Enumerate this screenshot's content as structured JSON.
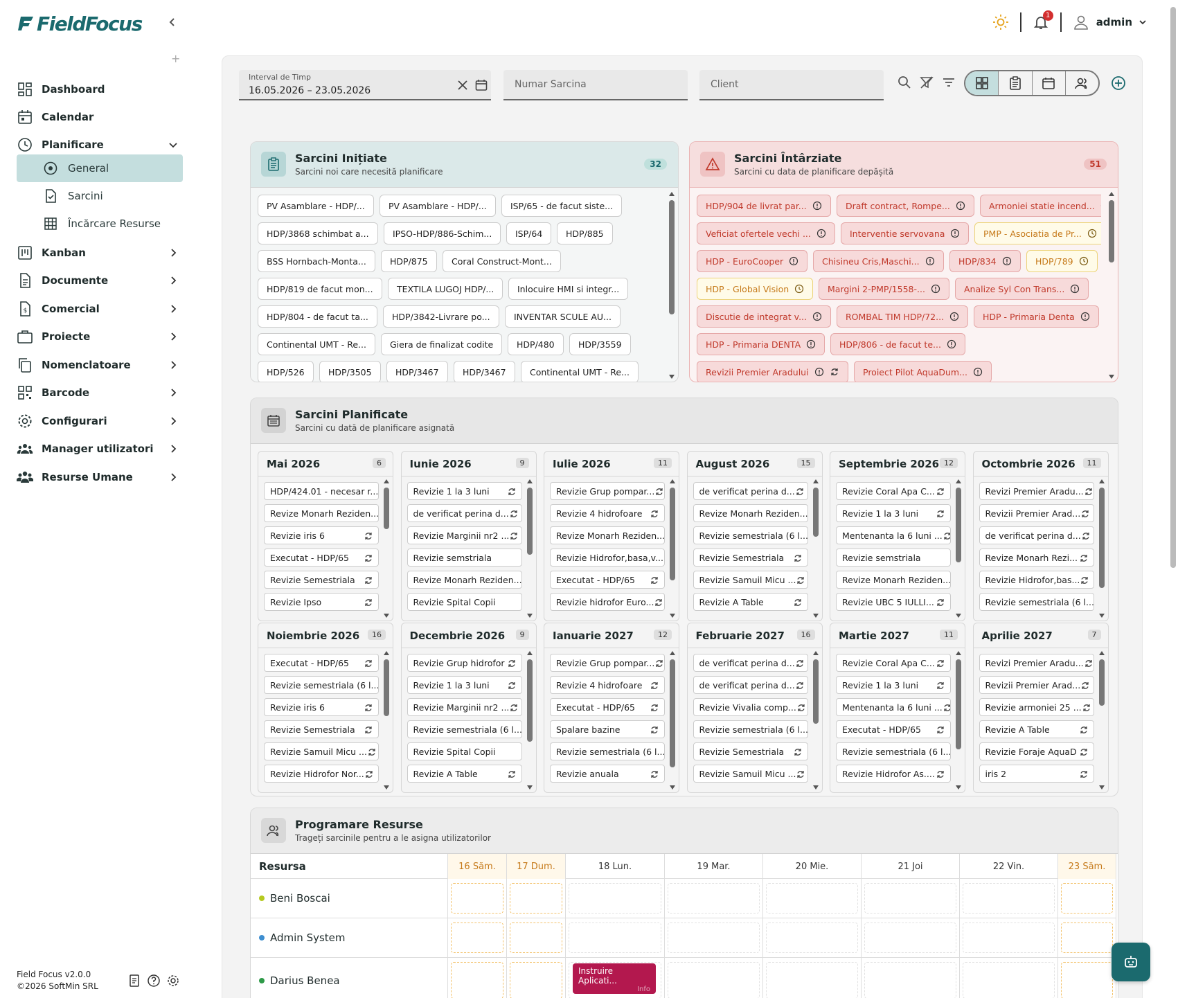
{
  "app": {
    "name": "FieldFocus",
    "version": "Field Focus v2.0.0",
    "copyright": "©2026 SoftMin SRL"
  },
  "colors": {
    "brand": "#1b6a6e",
    "active_nav": "#c4dede",
    "late_bg": "#f7dada",
    "late_text": "#c0392b",
    "event": "#b3184e"
  },
  "topbar": {
    "notif_count": "1",
    "user": "admin",
    "icons": [
      "sun-icon",
      "bell-icon",
      "user-icon",
      "chevron-down-icon"
    ]
  },
  "sidebar": {
    "items": [
      {
        "label": "Dashboard",
        "icon": "dashboard-icon"
      },
      {
        "label": "Calendar",
        "icon": "calendar-icon"
      },
      {
        "label": "Planificare",
        "icon": "clock-icon",
        "expanded": true
      },
      {
        "label": "Kanban",
        "icon": "kanban-icon"
      },
      {
        "label": "Documente",
        "icon": "document-icon"
      },
      {
        "label": "Comercial",
        "icon": "invoice-icon"
      },
      {
        "label": "Proiecte",
        "icon": "briefcase-icon"
      },
      {
        "label": "Nomenclatoare",
        "icon": "copy-icon"
      },
      {
        "label": "Barcode",
        "icon": "qr-icon"
      },
      {
        "label": "Configurari",
        "icon": "gear-icon"
      },
      {
        "label": "Manager utilizatori",
        "icon": "users-icon"
      },
      {
        "label": "Resurse Umane",
        "icon": "group-icon"
      }
    ],
    "subitems": [
      {
        "label": "General",
        "icon": "target-icon",
        "active": true
      },
      {
        "label": "Sarcini",
        "icon": "task-file-icon"
      },
      {
        "label": "Încărcare Resurse",
        "icon": "grid-icon"
      }
    ]
  },
  "filters": {
    "interval_label": "Interval de Timp",
    "interval_value": "16.05.2026 – 23.05.2026",
    "task_placeholder": "Numar Sarcina",
    "client_placeholder": "Client"
  },
  "initiated": {
    "title": "Sarcini Inițiate",
    "subtitle": "Sarcini noi care necesită planificare",
    "count": "32",
    "chips": [
      [
        "PV Asamblare - HDP/...",
        "PV Asamblare - HDP/...",
        "ISP/65 - de facut siste..."
      ],
      [
        "HDP/3868 schimbat a...",
        "IPSO-HDP/886-Schim...",
        "ISP/64",
        "HDP/885"
      ],
      [
        "BSS Hornbach-Monta...",
        "HDP/875",
        "Coral Construct-Mont..."
      ],
      [
        "HDP/819 de facut mon...",
        "TEXTILA LUGOJ HDP/...",
        "Inlocuire HMI si integr..."
      ],
      [
        "HDP/804 - de facut ta...",
        "HDP/3842-Livrare po...",
        "INVENTAR SCULE AU..."
      ],
      [
        "Continental UMT - Re...",
        "Giera de finalizat codite",
        "HDP/480",
        "HDP/3559"
      ],
      [
        "HDP/526",
        "HDP/3505",
        "HDP/3467",
        "HDP/3467",
        "Continental UMT - Re..."
      ]
    ]
  },
  "late": {
    "title": "Sarcini Întârziate",
    "subtitle": "Sarcini cu data de planificare depășită",
    "count": "51",
    "chips": [
      [
        {
          "t": "HDP/904 de livrat par...",
          "c": "red"
        },
        {
          "t": "Draft contract, Rompe...",
          "c": "red"
        },
        {
          "t": "Armoniei statie incend...",
          "c": "red"
        }
      ],
      [
        {
          "t": "Veficiat ofertele vechi ...",
          "c": "red"
        },
        {
          "t": "Interventie servovana",
          "c": "red"
        },
        {
          "t": "PMP - Asociatia de Pr...",
          "c": "yel"
        }
      ],
      [
        {
          "t": "HDP - EuroCooper",
          "c": "red"
        },
        {
          "t": "Chisineu Cris,Maschi...",
          "c": "red"
        },
        {
          "t": "HDP/834",
          "c": "red"
        },
        {
          "t": "HDP/789",
          "c": "yel"
        }
      ],
      [
        {
          "t": "HDP - Global Vision",
          "c": "yel"
        },
        {
          "t": "Margini 2-PMP/1558-...",
          "c": "red"
        },
        {
          "t": "Analize Syl Con Trans...",
          "c": "red"
        }
      ],
      [
        {
          "t": "Discutie de integrat v...",
          "c": "red"
        },
        {
          "t": "ROMBAL TIM HDP/72...",
          "c": "red"
        },
        {
          "t": "HDP - Primaria Denta",
          "c": "red"
        }
      ],
      [
        {
          "t": "HDP - Primaria DENTA",
          "c": "red"
        },
        {
          "t": "HDP/806 - de facut te...",
          "c": "red"
        }
      ],
      [
        {
          "t": "Revizii Premier Aradului",
          "c": "red",
          "recur": true
        },
        {
          "t": "Proiect Pilot AquaDum...",
          "c": "red"
        }
      ]
    ]
  },
  "planned": {
    "title": "Sarcini Planificate",
    "subtitle": "Sarcini cu dată de planificare asignată",
    "months": [
      {
        "name": "Mai 2026",
        "count": "6",
        "items": [
          "HDP/424.01 - necesar r...",
          "Revize Monarh Reziden...",
          "Revizie iris 6",
          "Executat - HDP/65",
          "Revizie Semestriala",
          "Revizie Ipso"
        ],
        "r": [
          0,
          0,
          1,
          1,
          1,
          1
        ]
      },
      {
        "name": "Iunie 2026",
        "count": "9",
        "items": [
          "Revizie 1 la 3 luni",
          "de verificat perina d...",
          "Revizie Marginii nr2 ...",
          "Revizie semstriala",
          "Revize Monarh Reziden...",
          "Revizie Spital Copii"
        ],
        "r": [
          1,
          1,
          1,
          0,
          0,
          0
        ]
      },
      {
        "name": "Iulie 2026",
        "count": "11",
        "items": [
          "Revizie Grup pompar...",
          "Revizie 4 hidrofoare",
          "Revize Monarh Reziden...",
          "Revizie Hidrofor,basa,v...",
          "Executat - HDP/65",
          "Revizie hidrofor Euro..."
        ],
        "r": [
          1,
          1,
          0,
          0,
          1,
          1
        ]
      },
      {
        "name": "August 2026",
        "count": "15",
        "items": [
          "de verificat perina d...",
          "Revize Monarh Reziden...",
          "Revizie semestriala (6 l...",
          "Revizie Semestriala",
          "Revizie Samuil Micu ...",
          "Revizie A Table"
        ],
        "r": [
          1,
          0,
          0,
          1,
          1,
          1
        ]
      },
      {
        "name": "Septembrie 2026",
        "count": "12",
        "items": [
          "Revizie Coral Apa C...",
          "Revizie 1 la 3 luni",
          "Mentenanta la 6 luni ...",
          "Revizie semstriala",
          "Revize Monarh Reziden...",
          "Revizie UBC 5 IULLI..."
        ],
        "r": [
          1,
          1,
          1,
          0,
          0,
          1
        ]
      },
      {
        "name": "Octombrie 2026",
        "count": "11",
        "items": [
          "Revizi Premier Aradu...",
          "Revizii Premier Arad...",
          "de verificat perina d...",
          "Revize Monarh Rezi...",
          "Revizie Hidrofor,bas...",
          "Revizie semestriala (6 l..."
        ],
        "r": [
          1,
          1,
          1,
          1,
          1,
          0
        ]
      },
      {
        "name": "Noiembrie 2026",
        "count": "16",
        "items": [
          "Executat - HDP/65",
          "Revizie semestriala (6 l...",
          "Revizie iris 6",
          "Revizie Semestriala",
          "Revizie Samuil Micu ...",
          "Revizie Hidrofor Nor..."
        ],
        "r": [
          1,
          0,
          1,
          1,
          1,
          1
        ]
      },
      {
        "name": "Decembrie 2026",
        "count": "9",
        "items": [
          "Revizie Grup hidrofor",
          "Revizie 1 la 3 luni",
          "Revizie Marginii nr2 ...",
          "Revizie semestriala (6 l...",
          "Revizie Spital Copii",
          "Revizie A Table"
        ],
        "r": [
          1,
          1,
          1,
          0,
          0,
          1
        ]
      },
      {
        "name": "Ianuarie 2027",
        "count": "12",
        "items": [
          "Revizie Grup pompar...",
          "Revizie 4 hidrofoare",
          "Executat - HDP/65",
          "Spalare bazine",
          "Revizie semestriala (6 l...",
          "Revizie anuala"
        ],
        "r": [
          1,
          1,
          1,
          1,
          0,
          1
        ]
      },
      {
        "name": "Februarie 2027",
        "count": "16",
        "items": [
          "de verificat perina d...",
          "de verificat perina d...",
          "Revizie Vivalia comp...",
          "Revizie semestriala (6 l...",
          "Revizie Semestriala",
          "Revizie Samuil Micu ..."
        ],
        "r": [
          1,
          1,
          1,
          0,
          1,
          1
        ]
      },
      {
        "name": "Martie 2027",
        "count": "11",
        "items": [
          "Revizie Coral Apa C...",
          "Revizie 1 la 3 luni",
          "Mentenanta la 6 luni ...",
          "Executat - HDP/65",
          "Revizie semestriala (6 l...",
          "Revizie Hidrofor As...."
        ],
        "r": [
          1,
          1,
          1,
          1,
          1,
          1
        ]
      },
      {
        "name": "Aprilie 2027",
        "count": "7",
        "items": [
          "Revizi Premier Aradu...",
          "Revizii Premier Arad...",
          "Revizie armoniei 25 ...",
          "Revizie A Table",
          "Revizie Foraje AquaD",
          "iris 2"
        ],
        "r": [
          1,
          1,
          1,
          1,
          1,
          1
        ]
      }
    ]
  },
  "schedule": {
    "title": "Programare Resurse",
    "subtitle": "Trageți sarcinile pentru a le asigna utilizatorilor",
    "resource_header": "Resursa",
    "days": [
      {
        "label": "16 Săm.",
        "weekend": true
      },
      {
        "label": "17 Dum.",
        "weekend": true
      },
      {
        "label": "18 Lun.",
        "weekend": false
      },
      {
        "label": "19 Mar.",
        "weekend": false
      },
      {
        "label": "20 Mie.",
        "weekend": false
      },
      {
        "label": "21 Joi",
        "weekend": false
      },
      {
        "label": "22 Vin.",
        "weekend": false
      },
      {
        "label": "23 Săm.",
        "weekend": true
      }
    ],
    "resources": [
      {
        "name": "Beni Boscai",
        "color": "#b5c91f"
      },
      {
        "name": "Admin System",
        "color": "#3e8ed0"
      },
      {
        "name": "Darius Benea",
        "color": "#2e9a48"
      }
    ],
    "event": {
      "title": "Instruire Aplicati...",
      "extra": "Info"
    }
  }
}
